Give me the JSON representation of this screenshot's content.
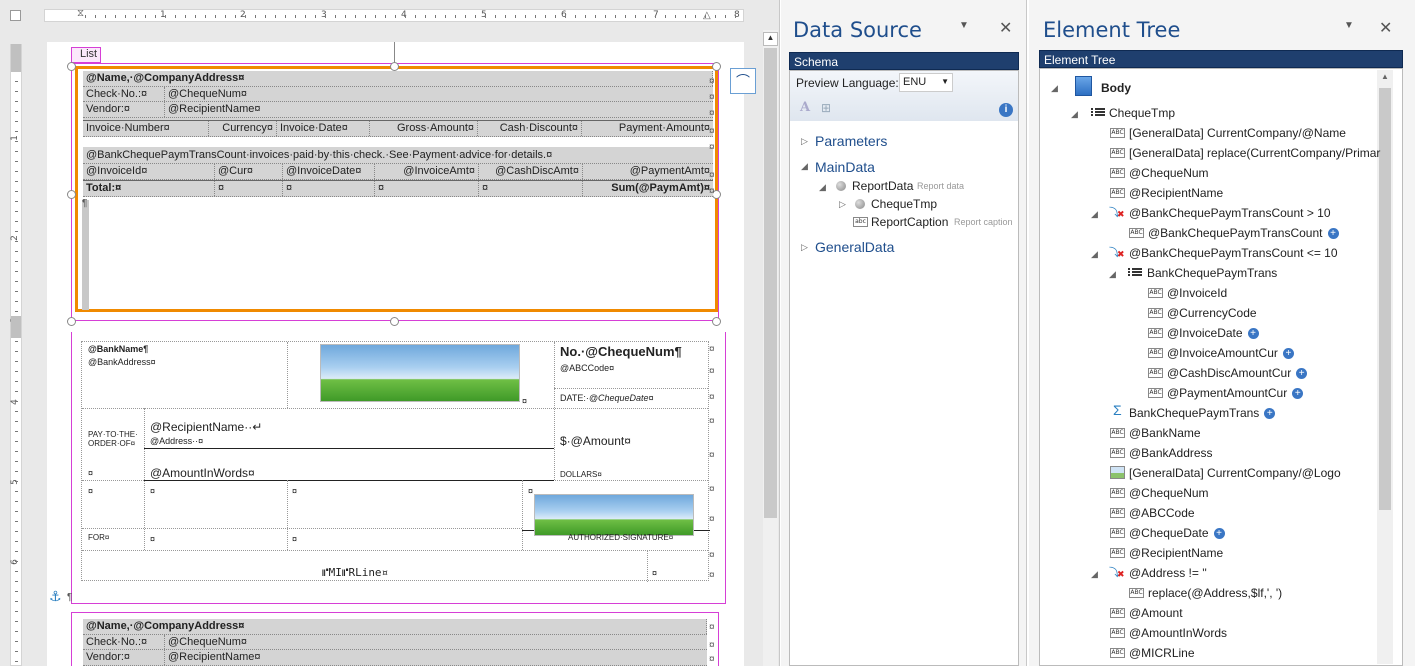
{
  "ruler": {
    "marks": [
      "1",
      "2",
      "3",
      "4",
      "5",
      "6",
      "7",
      "8"
    ]
  },
  "vruler": {
    "marks": [
      "1",
      "2",
      "3",
      "4",
      "5",
      "6"
    ]
  },
  "list_tag": "List",
  "table1": {
    "r0": "@Name,·@CompanyAddress¤",
    "r1a": "Check·No.:¤",
    "r1b": "@ChequeNum¤",
    "r2a": "Vendor:¤",
    "r2b": "@RecipientName¤",
    "hdr": [
      "Invoice·Number¤",
      "Currency¤",
      "Invoice·Date¤",
      "Gross·Amount¤",
      "Cash·Discount¤",
      "Payment·Amount¤"
    ],
    "note": "@BankChequePaymTransCount·invoices·paid·by·this·check.·See·Payment·advice·for·details.¤",
    "data": [
      "@InvoiceId¤",
      "@Cur¤",
      "@InvoiceDate¤",
      "@InvoiceAmt¤",
      "@CashDiscAmt¤",
      "@PaymentAmt¤"
    ],
    "total": [
      "Total:¤",
      "¤",
      "¤",
      "¤",
      "¤",
      "Sum(@PaymAmt)¤"
    ]
  },
  "check": {
    "bank_name": "@BankName¶",
    "bank_address": "@BankAddress¤",
    "cheque_no": "No.·@ChequeNum¶",
    "abc_code": "@ABCCode¤",
    "date_label": "DATE:·",
    "date_value": "@ChequeDate¤",
    "pay_to": "PAY·TO·THE·",
    "order_of": "ORDER·OF¤",
    "recipient": "@RecipientName··↵",
    "address": "@Address··¤",
    "amount": "$·@Amount¤",
    "amount_words": "@AmountInWords¤",
    "dollars": "DOLLARS¤",
    "for_label": "FOR¤",
    "auth_sig": "AUTHORIZED·SIGNATURE¤",
    "micr": "⑈MI⑈RLine¤",
    "cell_mark": "¤"
  },
  "table2": {
    "r0": "@Name,·@CompanyAddress¤",
    "r1a": "Check·No.:¤",
    "r1b": "@ChequeNum¤",
    "r2a": "Vendor:¤",
    "r2b": "@RecipientName¤"
  },
  "data_source": {
    "title": "Data Source",
    "header": "Schema",
    "preview_label": "Preview Language:",
    "preview_value": "ENU",
    "tree": {
      "parameters": "Parameters",
      "maindata": "MainData",
      "reportdata": "ReportData",
      "reportdata_desc": "Report data",
      "chequetmp": "ChequeTmp",
      "reportcaption": "ReportCaption",
      "reportcaption_desc": "Report caption",
      "generaldata": "GeneralData"
    }
  },
  "element_tree": {
    "title": "Element Tree",
    "header": "Element Tree",
    "items": [
      "Body",
      "ChequeTmp",
      "[GeneralData] CurrentCompany/@Name",
      "[GeneralData] replace(CurrentCompany/Primar",
      "@ChequeNum",
      "@RecipientName",
      "@BankChequePaymTransCount > 10",
      "@BankChequePaymTransCount",
      "@BankChequePaymTransCount <= 10",
      "BankChequePaymTrans",
      "@InvoiceId",
      "@CurrencyCode",
      "@InvoiceDate",
      "@InvoiceAmountCur",
      "@CashDiscAmountCur",
      "@PaymentAmountCur",
      "BankChequePaymTrans",
      "@BankName",
      "@BankAddress",
      "[GeneralData] CurrentCompany/@Logo",
      "@ChequeNum",
      "@ABCCode",
      "@ChequeDate",
      "@RecipientName",
      "@Address != ''",
      "replace(@Address,$lf,', ')",
      "@Amount",
      "@AmountInWords",
      "@MICRLine"
    ]
  },
  "colors": {
    "accent": "#1f4e8c",
    "selection": "#f08a00",
    "list_border": "#d63fd6",
    "header_bar": "#1f3f6e"
  }
}
